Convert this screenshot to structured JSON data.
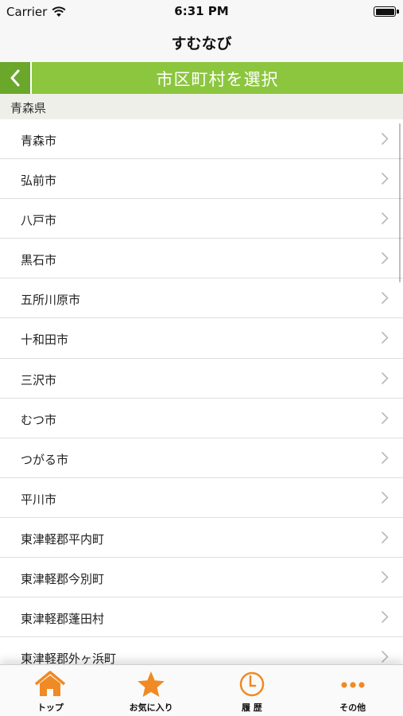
{
  "status_bar": {
    "carrier": "Carrier",
    "time": "6:31 PM"
  },
  "nav": {
    "title": "すむなび"
  },
  "header": {
    "title": "市区町村を選択"
  },
  "section": {
    "label": "青森県"
  },
  "rows": [
    "青森市",
    "弘前市",
    "八戸市",
    "黒石市",
    "五所川原市",
    "十和田市",
    "三沢市",
    "むつ市",
    "つがる市",
    "平川市",
    "東津軽郡平内町",
    "東津軽郡今別町",
    "東津軽郡蓬田村",
    "東津軽郡外ヶ浜町"
  ],
  "tabs": [
    {
      "label": "トップ",
      "icon": "home-icon"
    },
    {
      "label": "お気に入り",
      "icon": "star-icon"
    },
    {
      "label": "履 歴",
      "icon": "clock-icon"
    },
    {
      "label": "その他",
      "icon": "more-icon"
    }
  ],
  "colors": {
    "accent": "#8cc63f",
    "accent_dark": "#6aa72b",
    "tab_icon": "#f08a24"
  }
}
